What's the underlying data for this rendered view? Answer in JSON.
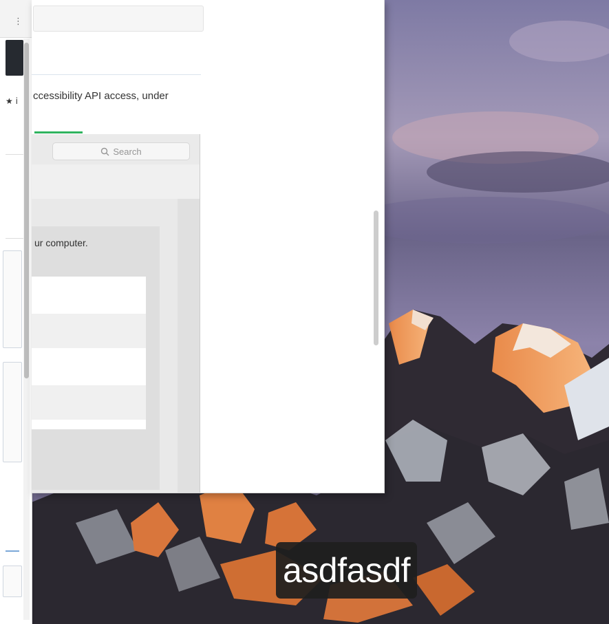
{
  "desktop": {
    "wallpaper": "macOS Sierra mountain wallpaper"
  },
  "left_window": {
    "menu_glyph": "⋮",
    "bookmark_glyph": "★ i"
  },
  "main_window": {
    "body_text": "ccessibility API access, under"
  },
  "preferences_window": {
    "search_placeholder": "Search",
    "panel_text": "ur computer."
  },
  "caption": {
    "text": "asdfasdf"
  },
  "colors": {
    "accent_green": "#2fb35f",
    "window_bg": "#ffffff",
    "caption_bg": "#1e1e1e"
  }
}
